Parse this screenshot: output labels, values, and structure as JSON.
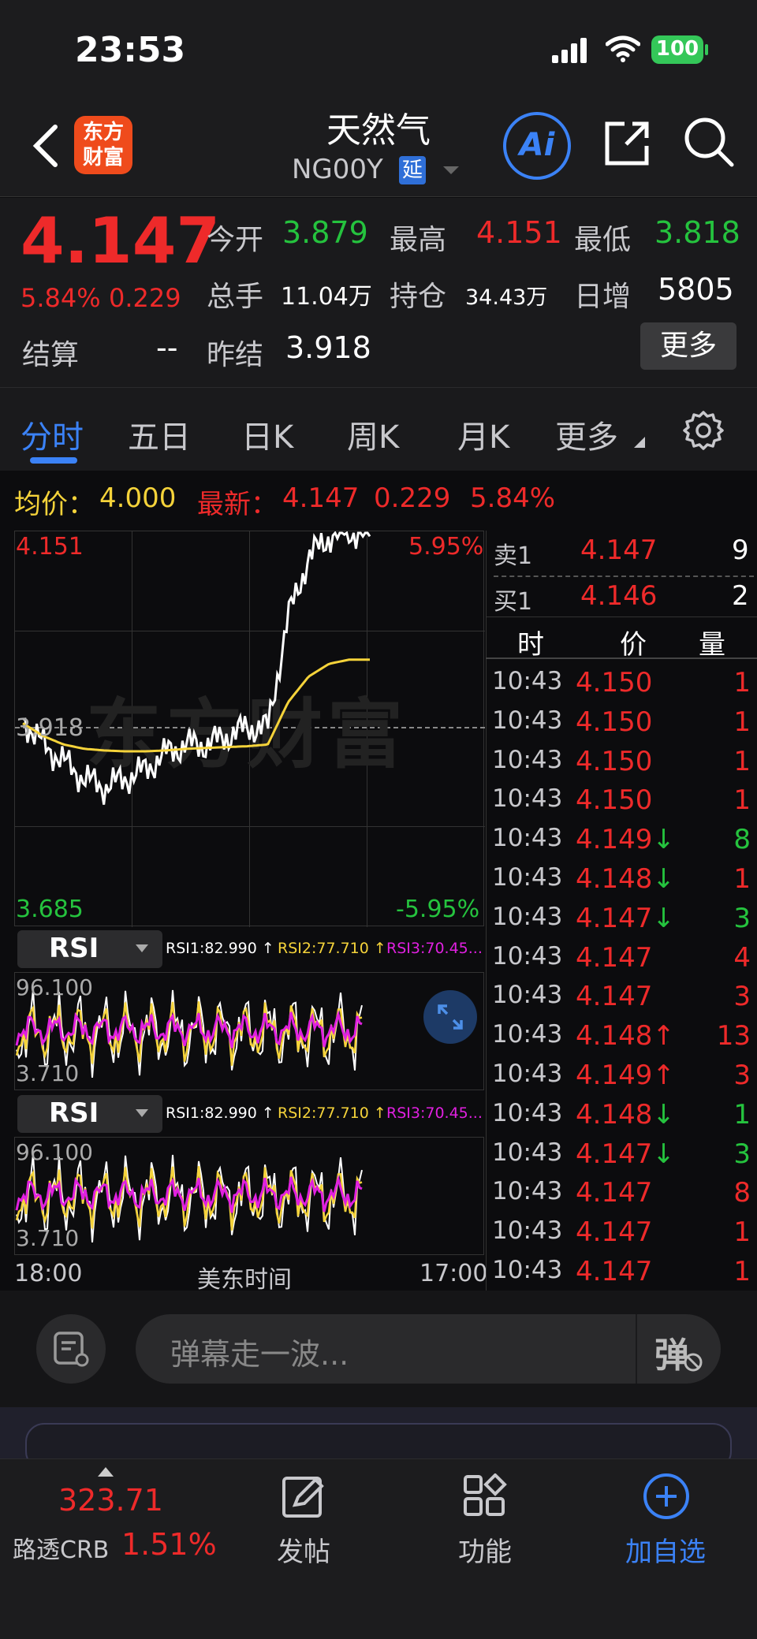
{
  "status": {
    "time": "23:53",
    "battery": "100"
  },
  "nav": {
    "logo_line1": "东方",
    "logo_line2": "财富",
    "title": "天然气",
    "code": "NG00Y",
    "delay_badge": "延",
    "icons": [
      "back-arrow-icon",
      "ai-icon",
      "share-icon",
      "search-icon"
    ]
  },
  "quote": {
    "price": "4.147",
    "change_pct": "5.84%",
    "change": "0.229",
    "open_label": "今开",
    "open": "3.879",
    "high_label": "最高",
    "high": "4.151",
    "low_label": "最低",
    "low": "3.818",
    "volume_label": "总手",
    "volume": "11.04万",
    "oi_label": "持仓",
    "oi": "34.43万",
    "daily_inc_label": "日增",
    "daily_inc": "5805",
    "settle_label": "结算",
    "settle": "--",
    "prev_settle_label": "昨结",
    "prev_settle": "3.918",
    "more_button": "更多"
  },
  "tabs": [
    "分时",
    "五日",
    "日K",
    "周K",
    "月K",
    "更多"
  ],
  "active_tab": "分时",
  "info_line": {
    "avg_label": "均价：",
    "avg": "4.000",
    "latest_label": "最新：",
    "latest": "4.147",
    "chg": "0.229",
    "pct": "5.84%"
  },
  "chart": {
    "max_price": "4.151",
    "max_pct": "5.95%",
    "min_price": "3.685",
    "min_pct": "-5.95%",
    "ref_price": "3.918",
    "watermark": "东方财富",
    "time_start": "18:00",
    "time_mid": "美东时间",
    "time_end": "17:00"
  },
  "chart_data": {
    "type": "line",
    "series": [
      {
        "name": "",
        "color": "#ffffff",
        "values": [
          3.93,
          3.9,
          3.88,
          3.86,
          3.85,
          3.86,
          3.87,
          3.89,
          3.9,
          3.9,
          3.91,
          3.92,
          3.92,
          4.05,
          4.12,
          4.145,
          4.151,
          4.147
        ]
      },
      {
        "name": "",
        "color": "#f5d33a",
        "values": [
          3.925,
          3.91,
          3.9,
          3.895,
          3.893,
          3.892,
          3.892,
          3.893,
          3.895,
          3.896,
          3.897,
          3.898,
          3.9,
          3.95,
          3.98,
          3.995,
          4.0,
          4.0
        ]
      }
    ],
    "ylim": [
      3.685,
      4.151
    ],
    "reference": 3.918
  },
  "rsi_panels": [
    {
      "selector": "RSI",
      "rsi1": "RSI1:82.990 ↑",
      "rsi2": "RSI2:77.710 ↑",
      "rsi3": "RSI3:70.45...",
      "top": "96.100",
      "bottom": "3.710"
    },
    {
      "selector": "RSI",
      "rsi1": "RSI1:82.990 ↑",
      "rsi2": "RSI2:77.710 ↑",
      "rsi3": "RSI3:70.45...",
      "top": "96.100",
      "bottom": "3.710"
    }
  ],
  "orderbook": {
    "ask_label": "卖1",
    "ask_price": "4.147",
    "ask_qty": "9",
    "bid_label": "买1",
    "bid_price": "4.146",
    "bid_qty": "2",
    "headers": [
      "时",
      "价",
      "量"
    ]
  },
  "trades": [
    {
      "time": "10:43",
      "price": "4.150",
      "arrow": "",
      "qty": "1",
      "pc": "red",
      "qc": "red"
    },
    {
      "time": "10:43",
      "price": "4.150",
      "arrow": "",
      "qty": "1",
      "pc": "red",
      "qc": "red"
    },
    {
      "time": "10:43",
      "price": "4.150",
      "arrow": "",
      "qty": "1",
      "pc": "red",
      "qc": "red"
    },
    {
      "time": "10:43",
      "price": "4.150",
      "arrow": "",
      "qty": "1",
      "pc": "red",
      "qc": "red"
    },
    {
      "time": "10:43",
      "price": "4.149",
      "arrow": "↓",
      "qty": "8",
      "pc": "red",
      "qc": "green"
    },
    {
      "time": "10:43",
      "price": "4.148",
      "arrow": "↓",
      "qty": "1",
      "pc": "red",
      "qc": "red"
    },
    {
      "time": "10:43",
      "price": "4.147",
      "arrow": "↓",
      "qty": "3",
      "pc": "red",
      "qc": "green"
    },
    {
      "time": "10:43",
      "price": "4.147",
      "arrow": "",
      "qty": "4",
      "pc": "red",
      "qc": "red"
    },
    {
      "time": "10:43",
      "price": "4.147",
      "arrow": "",
      "qty": "3",
      "pc": "red",
      "qc": "red"
    },
    {
      "time": "10:43",
      "price": "4.148",
      "arrow": "↑",
      "qty": "13",
      "pc": "red",
      "qc": "red"
    },
    {
      "time": "10:43",
      "price": "4.149",
      "arrow": "↑",
      "qty": "3",
      "pc": "red",
      "qc": "red"
    },
    {
      "time": "10:43",
      "price": "4.148",
      "arrow": "↓",
      "qty": "1",
      "pc": "red",
      "qc": "green"
    },
    {
      "time": "10:43",
      "price": "4.147",
      "arrow": "↓",
      "qty": "3",
      "pc": "red",
      "qc": "green"
    },
    {
      "time": "10:43",
      "price": "4.147",
      "arrow": "",
      "qty": "8",
      "pc": "red",
      "qc": "red"
    },
    {
      "time": "10:43",
      "price": "4.147",
      "arrow": "",
      "qty": "1",
      "pc": "red",
      "qc": "red"
    },
    {
      "time": "10:43",
      "price": "4.147",
      "arrow": "",
      "qty": "1",
      "pc": "red",
      "qc": "red"
    }
  ],
  "danmu": {
    "placeholder": "弹幕走一波...",
    "button": "弹"
  },
  "bottom_nav": {
    "index_value": "323.71",
    "index_name": "路透CRB",
    "index_pct": "1.51%",
    "items": [
      "发帖",
      "功能",
      "加自选"
    ]
  },
  "colors": {
    "up": "#ee2a2a",
    "down": "#25c33e",
    "accent": "#3b82f6",
    "avg": "#f5d33a"
  }
}
